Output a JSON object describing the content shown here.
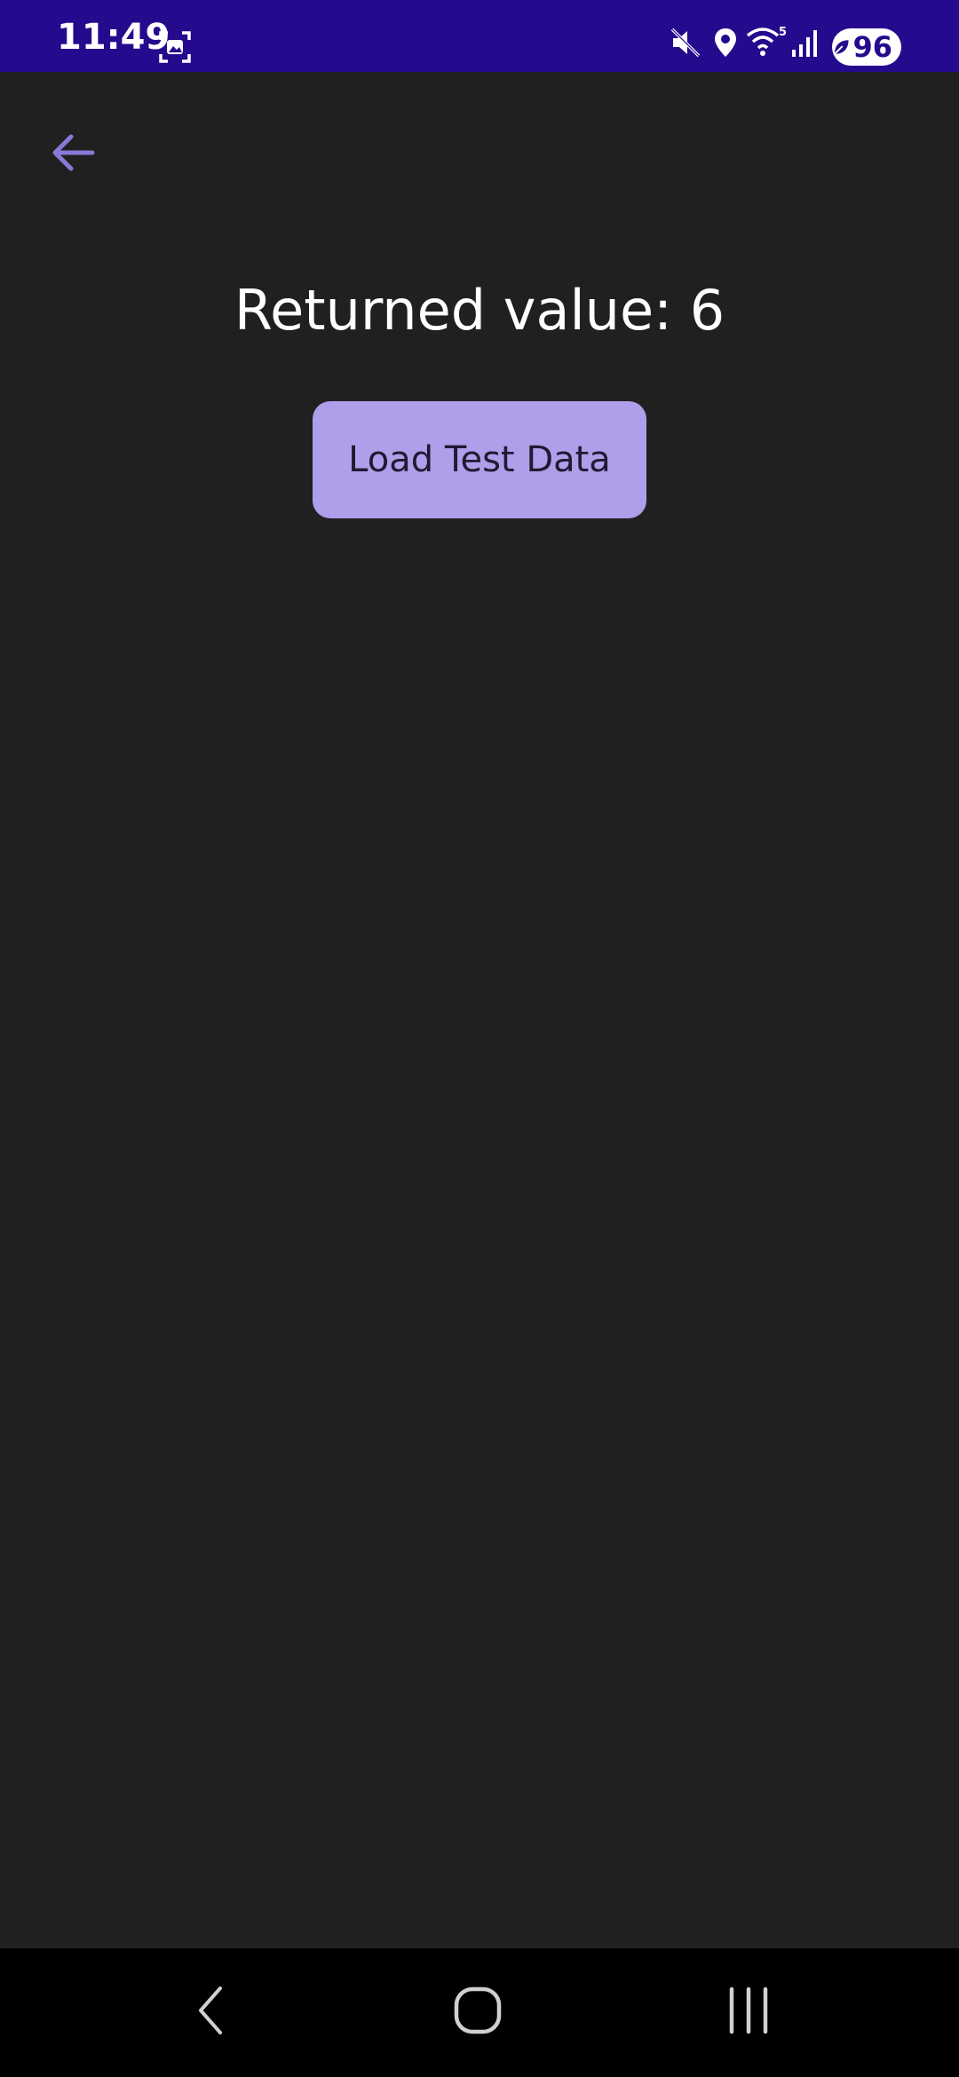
{
  "status_bar": {
    "time": "11:49",
    "battery": "96",
    "icons": [
      "screenshot-icon",
      "mute-icon",
      "location-icon",
      "wifi-icon",
      "signal-icon",
      "battery-leaf-icon"
    ],
    "background_color": "#250a8e"
  },
  "app": {
    "back_icon": "arrow-left-icon",
    "accent_color": "#8b78d6",
    "returned_value_text": "Returned value: 6",
    "load_button_label": "Load Test Data",
    "button_color": "#af9ee9",
    "background_color": "#202020"
  },
  "nav_bar": {
    "icons": [
      "back-nav-icon",
      "home-nav-icon",
      "recents-nav-icon"
    ]
  }
}
